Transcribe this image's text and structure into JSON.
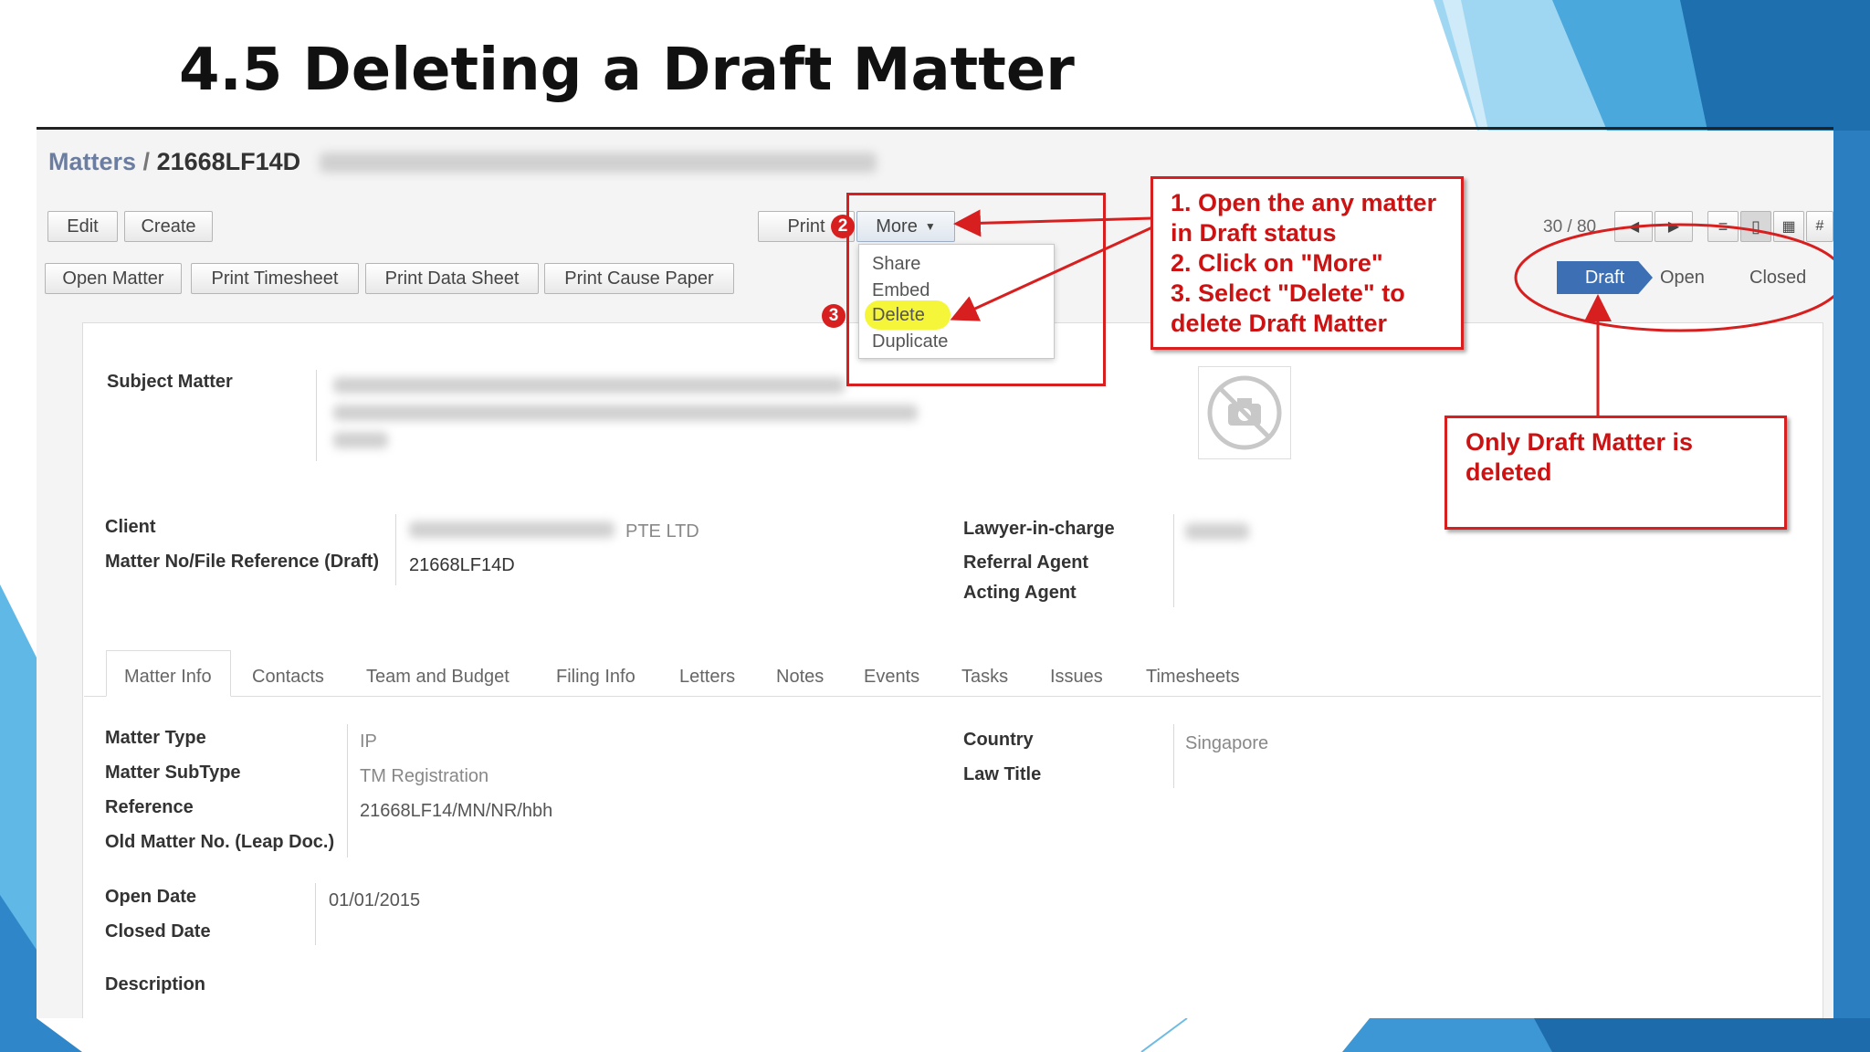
{
  "slide": {
    "title": "4.5 Deleting a Draft Matter"
  },
  "breadcrumb": {
    "root": "Matters",
    "separator": "/",
    "current": "21668LF14D"
  },
  "toolbar": {
    "edit": "Edit",
    "create": "Create",
    "print": "Print",
    "more": "More",
    "pager": "30 / 80"
  },
  "actions": {
    "open_matter": "Open Matter",
    "print_timesheet": "Print Timesheet",
    "print_data_sheet": "Print Data Sheet",
    "print_cause_paper": "Print Cause Paper"
  },
  "more_menu": {
    "items": [
      "Share",
      "Embed",
      "Delete",
      "Duplicate"
    ]
  },
  "status": {
    "draft": "Draft",
    "open": "Open",
    "closed": "Closed"
  },
  "form": {
    "subject_label": "Subject Matter",
    "client_label": "Client",
    "client_value_suffix": "PTE LTD",
    "matter_no_label": "Matter No/File Reference (Draft)",
    "matter_no_value": "21668LF14D",
    "lawyer_label": "Lawyer-in-charge",
    "referral_label": "Referral Agent",
    "acting_label": "Acting Agent"
  },
  "tabs": [
    "Matter Info",
    "Contacts",
    "Team and Budget",
    "Filing Info",
    "Letters",
    "Notes",
    "Events",
    "Tasks",
    "Issues",
    "Timesheets"
  ],
  "matter_info": {
    "matter_type_label": "Matter Type",
    "matter_type_value": "IP",
    "matter_subtype_label": "Matter SubType",
    "matter_subtype_value": "TM Registration",
    "reference_label": "Reference",
    "reference_value": "21668LF14/MN/NR/hbh",
    "old_matter_label": "Old Matter No. (Leap Doc.)",
    "country_label": "Country",
    "country_value": "Singapore",
    "law_title_label": "Law Title",
    "open_date_label": "Open Date",
    "open_date_value": "01/01/2015",
    "closed_date_label": "Closed Date",
    "description_label": "Description"
  },
  "annotations": {
    "steps": [
      "1. Open the any matter",
      "in Draft status",
      "2. Click on \"More\"",
      "3. Select \"Delete\" to",
      "delete Draft Matter"
    ],
    "note": [
      "Only Draft Matter is",
      "deleted"
    ],
    "badge_2": "2",
    "badge_3": "3"
  },
  "colors": {
    "accent_red": "#d81f1f",
    "draft_blue": "#3c6fb3",
    "highlight_yellow": "#f5f53a",
    "deco_blue": "#2b7fc1"
  }
}
